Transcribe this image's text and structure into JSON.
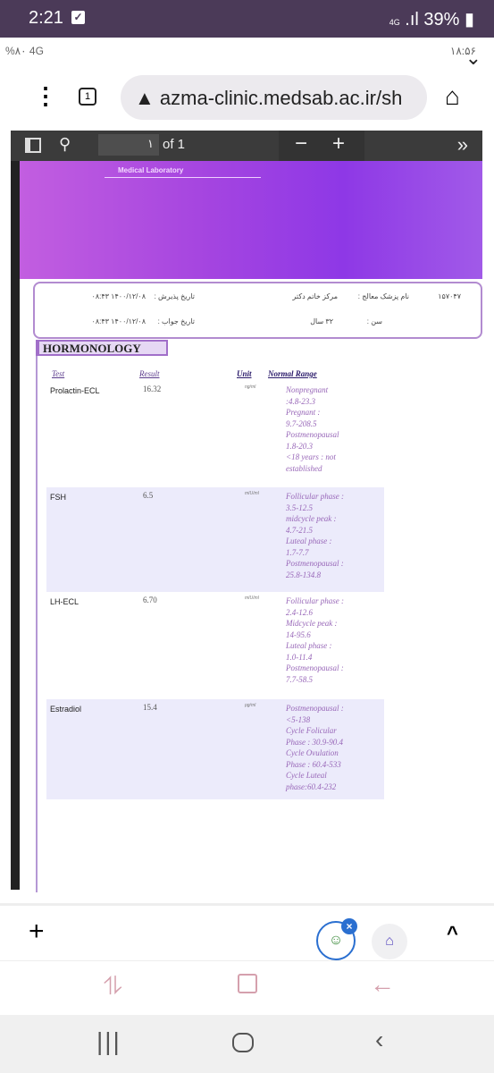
{
  "status_bar": {
    "time": "2:21",
    "network": "4G",
    "battery": "39%"
  },
  "inner_status": {
    "left": "%۸۰ 4G",
    "right": "۱۸:۵۶"
  },
  "browser": {
    "tabs_count": "1",
    "url": "azma-clinic.medsab.ac.ir/sh"
  },
  "pdf_toolbar": {
    "page": "۱",
    "of": "of 1",
    "zoom_out": "−",
    "zoom_in": "+",
    "more": "»"
  },
  "report": {
    "lab_title": "Medical Laboratory",
    "patient": {
      "reception_label": "تاریخ پذیرش :",
      "reception_date": "۱۴۰۰/۱۲/۰۸ ۰۸:۴۳",
      "answer_label": "تاریخ جواب :",
      "answer_date": "۱۴۰۰/۱۲/۰۸ ۰۸:۴۳",
      "doctor_label": "نام پزشک معالج :",
      "doctor": "مرکز خاتم دکتر",
      "age_label": "سن :",
      "age": "۳۲ سال",
      "id": "۱۵۷۰۴۷"
    },
    "section": "HORMONOLOGY",
    "headers": {
      "test": "Test",
      "result": "Result",
      "unit": "Unit",
      "range": "Normal Range"
    },
    "rows": [
      {
        "test": "Prolactin-ECL",
        "result": "16.32",
        "unit": "ng/ml",
        "range": [
          "Nonpregnant",
          ":4.8-23.3",
          "Pregnant :",
          "9.7-208.5",
          "Postmenopausal",
          "1.8-20.3",
          "<18 years : not",
          "established"
        ]
      },
      {
        "test": "FSH",
        "result": "6.5",
        "unit": "mIU/ml",
        "range": [
          "Follicular phase :",
          "3.5-12.5",
          "midcycle peak :",
          "4.7-21.5",
          "Luteal phase :",
          "1.7-7.7",
          "Postmenopausal :",
          "25.8-134.8"
        ]
      },
      {
        "test": "LH-ECL",
        "result": "6.70",
        "unit": "mIU/ml",
        "range": [
          "Follicular phase :",
          "2.4-12.6",
          "Midcycle peak :",
          "14-95.6",
          "Luteal phase :",
          "1.0-11.4",
          "Postmenopausal :",
          "7.7-58.5"
        ]
      },
      {
        "test": "Estradiol",
        "result": "15.4",
        "unit": "pg/ml",
        "range": [
          "Postmenopausal :",
          "<5-138",
          "Cycle Folicular",
          "Phase : 30.9-90.4",
          "Cycle Ovulation",
          "Phase : 60.4-533",
          "Cycle Luteal",
          "phase:60.4-232"
        ]
      }
    ]
  },
  "bottom_bar": {
    "add": "+",
    "up": "^"
  },
  "colors": {
    "status": "#4b3a58",
    "banner": "#a545e0",
    "row_shade": "#ecebfb"
  }
}
